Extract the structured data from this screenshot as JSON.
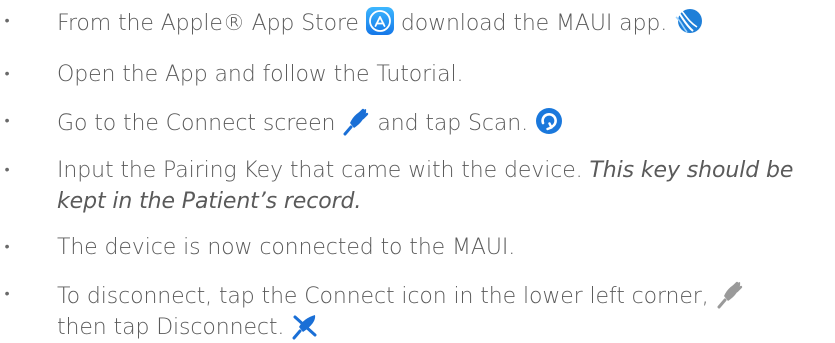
{
  "bullet_glyph": "•",
  "steps": [
    {
      "part1": "From the Apple® App Store",
      "part2": "download the MAUI app.",
      "icons": [
        "app-store-icon",
        "maui-app-icon"
      ]
    },
    {
      "text": "Open the App and follow the Tutorial."
    },
    {
      "part1": "Go to the Connect screen",
      "part2": "and tap Scan.",
      "icons": [
        "connect-plug-icon",
        "scan-refresh-icon"
      ]
    },
    {
      "text": "Input the Pairing Key that came with the device.",
      "italic": "This key should be kept in the Patient’s record."
    },
    {
      "text": "The device is now connected to the MAUI."
    },
    {
      "part1": "To disconnect, tap the Connect icon in the lower left corner,",
      "part2": "then tap Disconnect.",
      "icons": [
        "connect-plug-gray-icon",
        "disconnect-icon"
      ]
    }
  ],
  "colors": {
    "text": "#5a5a5a",
    "app_store_blue": "#1e8ff0",
    "connect_blue": "#1a6fd6",
    "disconnect_gray": "#9a9a9a"
  }
}
